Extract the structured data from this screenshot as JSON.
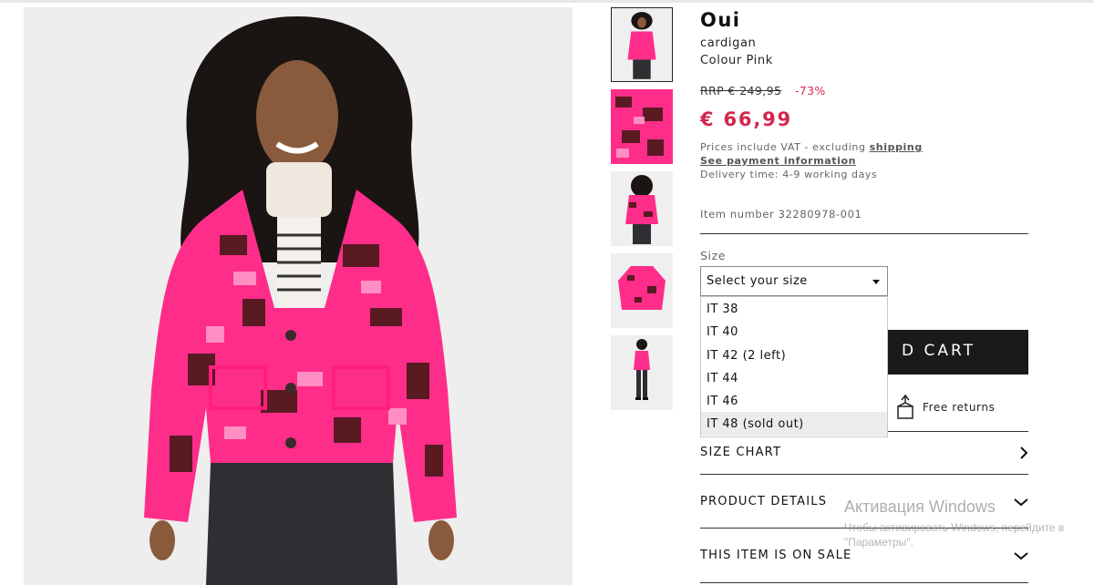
{
  "product": {
    "brand": "Oui",
    "type": "cardigan",
    "colour": "Colour Pink",
    "rrp": "RRP € 249,95",
    "discount": "-73%",
    "price": "€ 66,99",
    "vat_text": "Prices include VAT - excluding ",
    "shipping_link": "shipping",
    "payment_link": "See payment information",
    "delivery": "Delivery time: 4-9 working days",
    "item_number": "Item number 32280978-001"
  },
  "size": {
    "label": "Size",
    "placeholder": "Select your size",
    "options": [
      "IT 38",
      "IT 40",
      "IT 42 (2 left)",
      "IT 44",
      "IT 46",
      "IT 48 (sold out)"
    ]
  },
  "cart_button": "D CART",
  "returns": "Free returns",
  "accordions": [
    "SIZE CHART",
    "PRODUCT DETAILS",
    "THIS ITEM IS ON SALE"
  ],
  "thumbnails": [
    "front-view",
    "fabric-detail",
    "back-view",
    "flat-lay",
    "full-body"
  ],
  "windows_watermark": {
    "title": "Активация Windows",
    "subtitle": "Чтобы активировать Windows, перейдите в",
    "subtitle2": "\"Параметры\"."
  },
  "colors": {
    "accent": "#d2264f",
    "button": "#1a1a1a",
    "garment_pink": "#ff2d8a"
  }
}
